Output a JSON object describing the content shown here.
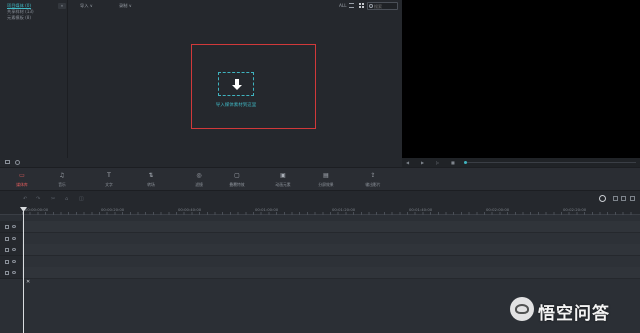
{
  "media_tree": {
    "items": [
      {
        "label": "项目媒体 (0)",
        "active": true
      },
      {
        "label": "共享样材 (13)",
        "active": false
      },
      {
        "label": "元素模板 (8)",
        "active": false
      }
    ],
    "collapse_label": "«"
  },
  "media_toolbar": {
    "import_label": "导入 ∨",
    "record_label": "录制 ∨",
    "view_all_label": "ALL",
    "search": {
      "placeholder": "搜索"
    }
  },
  "drop_zone": {
    "label": "导入媒体素材到这里",
    "border_color": "#d1393a",
    "accent_color": "#3fb4c0"
  },
  "preview": {
    "controls": [
      "◀",
      "▶",
      "▷",
      "■"
    ]
  },
  "module_tabs": [
    {
      "label": "媒体库",
      "icon": "folder-icon",
      "glyph": "▭",
      "active": true
    },
    {
      "label": "音乐",
      "icon": "music-icon",
      "glyph": "♫",
      "active": false
    },
    {
      "label": "文字",
      "icon": "text-icon",
      "glyph": "T",
      "active": false
    },
    {
      "label": "转场",
      "icon": "transition-icon",
      "glyph": "⇅",
      "active": false
    },
    {
      "label": "滤镜",
      "icon": "filter-icon",
      "glyph": "◎",
      "active": false
    },
    {
      "label": "叠覆特效",
      "icon": "overlay-icon",
      "glyph": "▢",
      "active": false
    },
    {
      "label": "动画元素",
      "icon": "element-icon",
      "glyph": "▣",
      "active": false
    },
    {
      "label": "分屏效果",
      "icon": "split-screen-icon",
      "glyph": "▤",
      "active": false
    },
    {
      "label": "输出影片",
      "icon": "export-icon",
      "glyph": "⇪",
      "active": false
    }
  ],
  "timeline_tools": [
    "↶",
    "↷",
    "✂",
    "⌂",
    "◫"
  ],
  "ruler": {
    "timecodes": [
      "00:00:00:00",
      "00:00:20:00",
      "00:00:40:00",
      "00:01:00:00",
      "00:01:20:00",
      "00:01:40:00",
      "00:02:00:00",
      "00:02:20:00"
    ]
  },
  "tracks": [
    {
      "name": "video-track-2",
      "icon": "video-icon"
    },
    {
      "name": "video-track-1",
      "icon": "film-icon"
    },
    {
      "name": "text-track",
      "icon": "text-icon"
    },
    {
      "name": "audio-track-1",
      "icon": "music-icon"
    },
    {
      "name": "audio-track-2",
      "icon": "music-icon"
    }
  ],
  "timeline_mute_glyph": "✕",
  "watermark": {
    "text": "悟空问答"
  }
}
